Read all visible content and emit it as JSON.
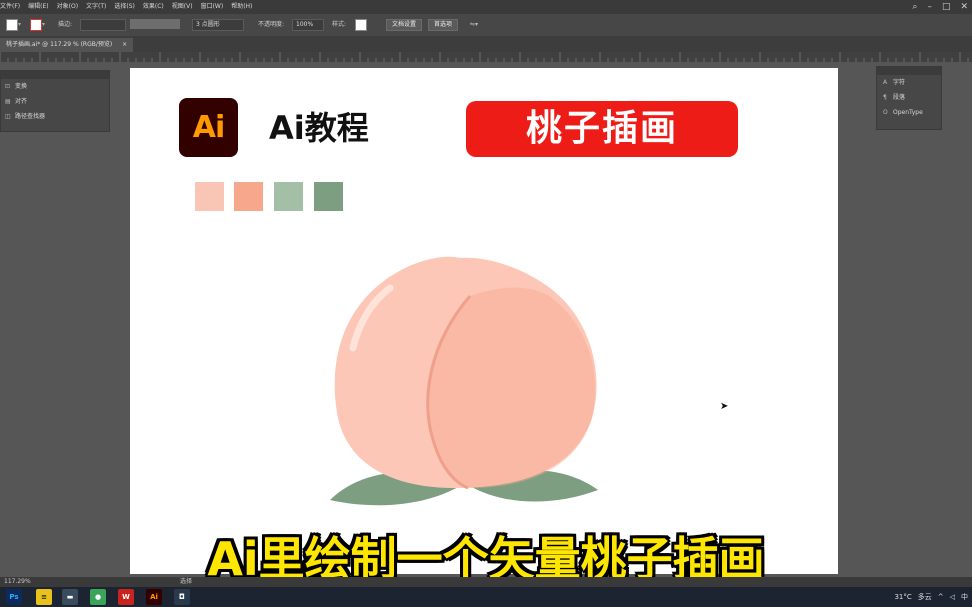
{
  "menubar": {
    "items": [
      "文件(F)",
      "编辑(E)",
      "对象(O)",
      "文字(T)",
      "选择(S)",
      "效果(C)",
      "视图(V)",
      "窗口(W)",
      "帮助(H)"
    ]
  },
  "controlbar": {
    "stroke_label": "描边:",
    "brush_value": "3 点圆形",
    "opacity_label": "不透明度:",
    "opacity_value": "100%",
    "style_label": "样式:",
    "doc_setup": "文档设置",
    "preferences": "首选项"
  },
  "tab": {
    "label": "桃子插画.ai* @ 117.29 % (RGB/预览)",
    "close": "×"
  },
  "left_panel": {
    "items": [
      {
        "icon": "transform-icon",
        "label": "变换"
      },
      {
        "icon": "align-icon",
        "label": "对齐"
      },
      {
        "icon": "pathfinder-icon",
        "label": "路径查找器"
      }
    ]
  },
  "right_panel": {
    "items": [
      {
        "icon": "character-icon",
        "label": "字符"
      },
      {
        "icon": "paragraph-icon",
        "label": "段落"
      },
      {
        "icon": "opentype-icon",
        "label": "OpenType"
      }
    ]
  },
  "artboard": {
    "logo_text": "Ai",
    "title": "Ai教程",
    "banner": "桃子插画",
    "palette": [
      "#f9c5b5",
      "#f6a78c",
      "#a3bfa5",
      "#7d9e80"
    ],
    "colors": {
      "peach_light": "#fcc7b6",
      "peach_mid": "#f6a990",
      "peach_highlight": "#ffe2d8",
      "leaf": "#7d9e80",
      "banner_red": "#ee1c17",
      "logo_bg": "#330000",
      "logo_orange": "#ff9a00"
    }
  },
  "caption": "Ai里绘制一个矢量桃子插画",
  "statusbar": {
    "zoom": "117.29%",
    "tool": "选择"
  },
  "tray": {
    "temp": "31°C",
    "weather": "多云",
    "ime": "中"
  }
}
